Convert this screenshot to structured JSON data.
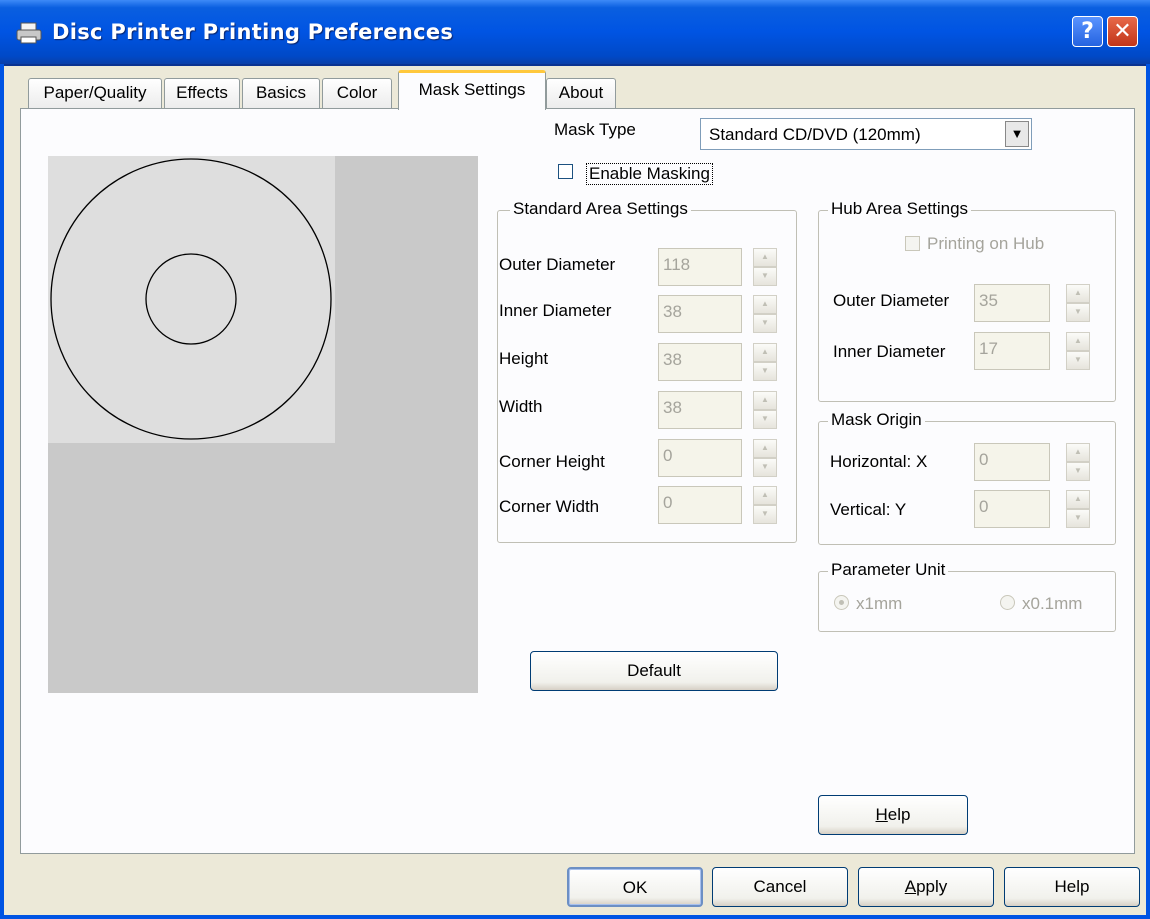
{
  "window": {
    "title": "Disc Printer Printing Preferences",
    "help_glyph": "?",
    "close_glyph": "✕"
  },
  "tabs": [
    {
      "label": "Paper/Quality",
      "active": false
    },
    {
      "label": "Effects",
      "active": false
    },
    {
      "label": "Basics",
      "active": false
    },
    {
      "label": "Color",
      "active": false
    },
    {
      "label": "Mask Settings",
      "active": true
    },
    {
      "label": "About",
      "active": false
    }
  ],
  "mask": {
    "type_label": "Mask Type",
    "type_value": "Standard CD/DVD (120mm)",
    "enable_label": "Enable Masking",
    "enable_checked": false
  },
  "standard_area": {
    "title": "Standard Area Settings",
    "fields": [
      {
        "label": "Outer Diameter",
        "value": "118"
      },
      {
        "label": "Inner Diameter",
        "value": "38"
      },
      {
        "label": "Height",
        "value": "38"
      },
      {
        "label": "Width",
        "value": "38"
      },
      {
        "label": "Corner Height",
        "value": "0"
      },
      {
        "label": "Corner Width",
        "value": "0"
      }
    ]
  },
  "hub_area": {
    "title": "Hub Area Settings",
    "printing_on_hub_label": "Printing on Hub",
    "printing_on_hub_checked": false,
    "fields": [
      {
        "label": "Outer Diameter",
        "value": "35"
      },
      {
        "label": "Inner Diameter",
        "value": "17"
      }
    ]
  },
  "mask_origin": {
    "title": "Mask Origin",
    "fields": [
      {
        "label": "Horizontal: X",
        "value": "0"
      },
      {
        "label": "Vertical: Y",
        "value": "0"
      }
    ]
  },
  "parameter_unit": {
    "title": "Parameter Unit",
    "options": [
      {
        "label": "x1mm",
        "selected": true
      },
      {
        "label": "x0.1mm",
        "selected": false
      }
    ]
  },
  "buttons": {
    "default": "Default",
    "help_panel_prefix": "H",
    "help_panel_rest": "elp",
    "ok": "OK",
    "cancel": "Cancel",
    "apply_prefix": "A",
    "apply_rest": "pply",
    "help": "Help"
  },
  "preview": {
    "outer_diameter": 118,
    "inner_diameter": 38
  },
  "colors": {
    "titlebar": "#0054e3",
    "tab_highlight": "#ffc83c",
    "preview_bg": "#c9c9c9",
    "preview_area": "#dedede"
  }
}
